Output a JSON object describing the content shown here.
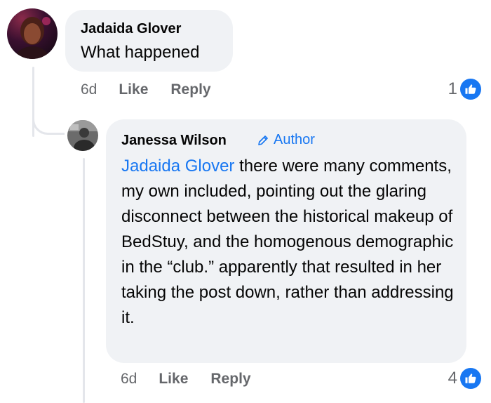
{
  "comment": {
    "author": "Jadaida Glover",
    "text": "What happened",
    "time": "6d",
    "like_label": "Like",
    "reply_label": "Reply",
    "reaction_count": "1",
    "reaction_icon": "like-icon"
  },
  "reply": {
    "author": "Janessa Wilson",
    "badge": "Author",
    "mention": "Jadaida Glover",
    "text": " there were many comments, my own included, pointing out the glaring disconnect between the historical makeup of BedStuy, and the homogenous demographic in the “club.” apparently that resulted in her taking the post down, rather than addressing it.",
    "time": "6d",
    "like_label": "Like",
    "reply_label": "Reply",
    "reaction_count": "4",
    "reaction_icon": "like-icon"
  },
  "colors": {
    "link": "#1877f2",
    "bubble": "#f0f2f5",
    "meta": "#65676b",
    "thread_line": "#e4e6eb"
  }
}
